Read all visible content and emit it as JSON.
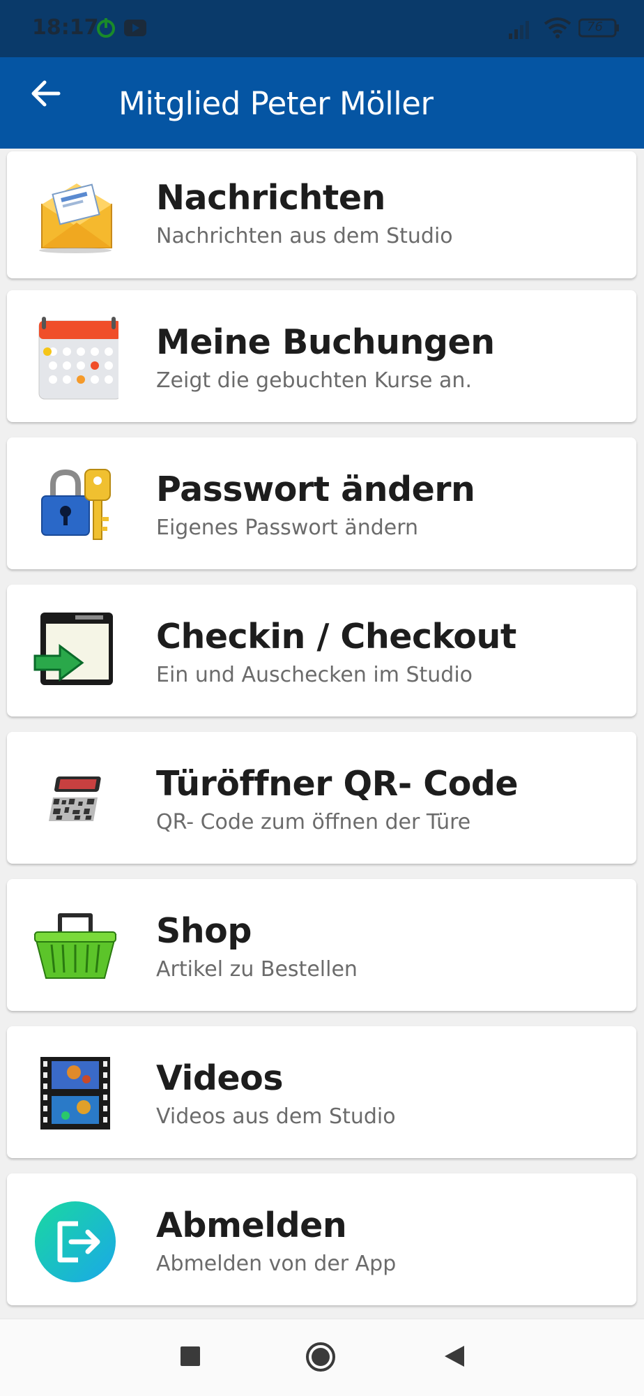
{
  "status_bar": {
    "time": "18:17",
    "battery": "76",
    "icons": [
      "power-icon",
      "youtube-icon",
      "signal-icon",
      "wifi-icon",
      "battery-icon"
    ]
  },
  "app_bar": {
    "title": "Mitglied Peter Möller",
    "back_icon": "arrow-left-icon",
    "color": "#0555a3"
  },
  "menu": {
    "items": [
      {
        "title": "Nachrichten",
        "subtitle": "Nachrichten aus dem Studio",
        "icon": "envelope-icon"
      },
      {
        "title": "Meine Buchungen",
        "subtitle": "Zeigt die gebuchten Kurse an.",
        "icon": "calendar-icon"
      },
      {
        "title": "Passwort ändern",
        "subtitle": "Eigenes Passwort ändern",
        "icon": "lock-key-icon"
      },
      {
        "title": "Checkin / Checkout",
        "subtitle": "Ein und Auschecken im Studio",
        "icon": "enter-window-icon"
      },
      {
        "title": "Türöffner QR- Code",
        "subtitle": "QR- Code zum öffnen der Türe",
        "icon": "qr-phone-icon"
      },
      {
        "title": "Shop",
        "subtitle": "Artikel zu Bestellen",
        "icon": "basket-icon"
      },
      {
        "title": "Videos",
        "subtitle": "Videos aus dem Studio",
        "icon": "film-icon"
      },
      {
        "title": "Abmelden",
        "subtitle": "Abmelden von der App",
        "icon": "logout-icon"
      }
    ]
  },
  "nav_bar": {
    "buttons": [
      "recents-square-icon",
      "home-circle-icon",
      "back-triangle-icon"
    ]
  }
}
